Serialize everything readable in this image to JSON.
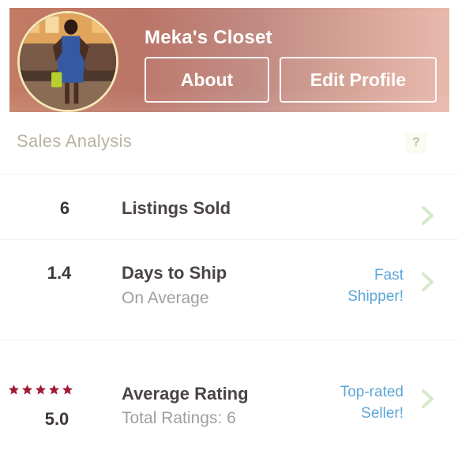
{
  "profile": {
    "shop_name": "Meka's Closet",
    "about_label": "About",
    "edit_label": "Edit Profile"
  },
  "sales": {
    "section_title": "Sales Analysis",
    "help_label": "?",
    "rows": [
      {
        "value": "6",
        "label": "Listings Sold",
        "sublabel": "",
        "badge_line1": "",
        "badge_line2": ""
      },
      {
        "value": "1.4",
        "label": "Days to Ship",
        "sublabel": "On Average",
        "badge_line1": "Fast",
        "badge_line2": "Shipper!"
      },
      {
        "value": "5.0",
        "label": "Average Rating",
        "sublabel": "Total Ratings: 6",
        "badge_line1": "Top-rated",
        "badge_line2": "Seller!"
      }
    ],
    "rating_stars": 5
  },
  "colors": {
    "header_gradient_start": "#c27c63",
    "header_gradient_end": "#e9b8ad",
    "badge_blue": "#5ca6d8",
    "star_red": "#a11c35",
    "chevron_green": "#d6e9cd"
  },
  "icons": {
    "help": "question-mark-icon",
    "chevron": "chevron-right-icon",
    "star": "star-icon"
  }
}
